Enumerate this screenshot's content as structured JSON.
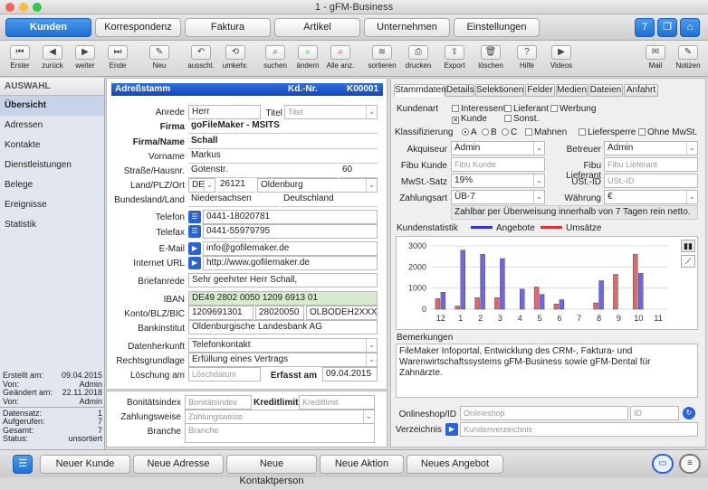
{
  "window": {
    "title": "1 - gFM-Business"
  },
  "nav": {
    "tabs": [
      "Kunden",
      "Korrespondenz",
      "Faktura",
      "Artikel",
      "Unternehmen",
      "Einstellungen"
    ]
  },
  "toolbar": {
    "items": [
      "Erster",
      "zurück",
      "weiter",
      "Ende",
      "Neu",
      "ausschl.",
      "umkehr.",
      "suchen",
      "ändern",
      "Alle anz.",
      "sortieren",
      "drucken",
      "Export",
      "löschen",
      "Hilfe",
      "Videos",
      "Mail",
      "Notizen"
    ]
  },
  "sidebar": {
    "header": "AUSWAHL",
    "items": [
      "Übersicht",
      "Adressen",
      "Kontakte",
      "Dienstleistungen",
      "Belege",
      "Ereignisse",
      "Statistik"
    ],
    "meta": [
      [
        "Erstellt am:",
        "09.04.2015"
      ],
      [
        "Von:",
        "Admin"
      ],
      [
        "Geändert am:",
        "22.11.2018"
      ],
      [
        "Von:",
        "Admin"
      ],
      [
        "Datensatz:",
        "1"
      ],
      [
        "Aufgerufen:",
        "7"
      ],
      [
        "Gesamt:",
        "7"
      ],
      [
        "Status:",
        "unsortiert"
      ]
    ]
  },
  "address": {
    "header": "Adreßstamm",
    "kdnr_label": "Kd.-Nr.",
    "kdnr": "K00001",
    "labels": {
      "anrede": "Anrede",
      "titel": "Titel",
      "firma": "Firma",
      "firma_name": "Firma/Name",
      "vorname": "Vorname",
      "strasse": "Straße/Hausnr.",
      "land": "Land/PLZ/Ort",
      "bundesland": "Bundesland/Land",
      "telefon": "Telefon",
      "telefax": "Telefax",
      "email": "E-Mail",
      "internet": "Internet URL",
      "briefanrede": "Briefanrede",
      "iban": "IBAN",
      "konto": "Konto/BLZ/BIC",
      "bank": "Bankinstitut",
      "datenherkunft": "Datenherkunft",
      "rechtsgrundlage": "Rechtsgrundlage",
      "loeschung": "Löschung am",
      "erfasst": "Erfasst am"
    },
    "values": {
      "anrede": "Herr",
      "titel_ph": "Titel",
      "firma": "goFileMaker - MSITS",
      "firma_name": "Schall",
      "vorname": "Markus",
      "strasse": "Gotenstr.",
      "hausnr": "60",
      "land": "DE",
      "plz": "26121",
      "ort": "Oldenburg",
      "bundesland": "Niedersachsen",
      "landname": "Deutschland",
      "telefon": "0441-18020781",
      "telefax": "0441-55979795",
      "email": "info@gofilemaker.de",
      "internet": "http://www.gofilemaker.de",
      "briefanrede": "Sehr geehrter Herr Schall,",
      "iban": "DE49 2802 0050 1209 6913 01",
      "konto": "1209691301",
      "blz": "28020050",
      "bic": "OLBODEH2XXX",
      "bank": "Oldenburgische Landesbank AG",
      "datenherkunft": "Telefonkontakt",
      "rechtsgrundlage": "Erfüllung eines Vertrags",
      "loeschung_ph": "Löschdatum",
      "erfasst": "09.04.2015"
    }
  },
  "bonitaet": {
    "labels": {
      "bonitaetsindex": "Bonitätsindex",
      "kreditlimit": "Kreditlimit",
      "zahlungsweise": "Zahlungsweise",
      "branche": "Branche"
    },
    "placeholders": {
      "bonitaetsindex": "Bonitätsindex",
      "kreditlimit": "Kreditlimit",
      "zahlungsweise": "Zahlungsweise",
      "branche": "Branche"
    }
  },
  "tabs": [
    "Stammdaten",
    "Details",
    "Selektionen",
    "Felder",
    "Medien",
    "Dateien",
    "Anfahrt"
  ],
  "stammdaten": {
    "kundenart_label": "Kundenart",
    "kundenart": [
      [
        "Interessent",
        false
      ],
      [
        "Lieferant",
        false
      ],
      [
        "Werbung",
        false
      ],
      [
        "Kunde",
        true
      ],
      [
        "Sonst.",
        false
      ]
    ],
    "klass_label": "Klassifizierung",
    "klass": [
      [
        "A",
        true
      ],
      [
        "B",
        false
      ],
      [
        "C",
        false
      ]
    ],
    "flags": [
      [
        "Mahnen",
        false
      ],
      [
        "Liefersperre",
        false
      ],
      [
        "Ohne MwSt.",
        false
      ]
    ],
    "labels": {
      "akquiseur": "Akquiseur",
      "betreuer": "Betreuer",
      "fibu_kunde": "Fibu Kunde",
      "fibu_lieferant": "Fibu Lieferant",
      "mwst": "MwSt.-Satz",
      "ustid": "USt.-ID",
      "zahlungsart": "Zahlungsart",
      "waehrung": "Währung"
    },
    "values": {
      "akquiseur": "Admin",
      "betreuer": "Admin",
      "fibu_kunde_ph": "Fibu Kunde",
      "fibu_lieferant_ph": "Fibu Lieferant",
      "mwst": "19%",
      "ustid_ph": "USt.-ID",
      "zahlungsart": "ÜB-7",
      "waehrung": "€",
      "zahlungstext": "Zahlbar per Überweisung innerhalb von 7 Tagen rein netto."
    }
  },
  "stats": {
    "title": "Kundenstatistik",
    "legend": [
      {
        "name": "Angebote",
        "color": "#3333dd"
      },
      {
        "name": "Umsätze",
        "color": "#dd3333"
      }
    ]
  },
  "chart_data": {
    "type": "bar",
    "categories": [
      "12",
      "1",
      "2",
      "3",
      "4",
      "5",
      "6",
      "7",
      "8",
      "9",
      "10",
      "11"
    ],
    "ylim": [
      0,
      3000
    ],
    "yticks": [
      0,
      1000,
      2000,
      3000
    ],
    "series": [
      {
        "name": "Umsätze",
        "color": "#e06a6a",
        "values": [
          500,
          150,
          550,
          550,
          0,
          1050,
          250,
          0,
          300,
          1650,
          2600,
          0
        ]
      },
      {
        "name": "Angebote",
        "color": "#6f68e6",
        "values": [
          800,
          2800,
          2600,
          2400,
          950,
          700,
          450,
          0,
          1350,
          0,
          1700,
          0
        ]
      }
    ]
  },
  "bemerkungen": {
    "label": "Bemerkungen",
    "text": "FileMaker Infoportal, Entwicklung des CRM-, Faktura- und Warenwirtschaftssystems gFM-Business sowie gFM-Dental für Zahnärzte."
  },
  "online": {
    "shop_label": "Onlineshop/ID",
    "shop_ph": "Onlineshop",
    "id_ph": "ID",
    "verz_label": "Verzeichnis",
    "verz_ph": "Kundenverzeichnis"
  },
  "bottom": {
    "buttons": [
      "Neuer Kunde",
      "Neue Adresse",
      "Neue Kontaktperson",
      "Neue Aktion",
      "Neues Angebot"
    ]
  }
}
